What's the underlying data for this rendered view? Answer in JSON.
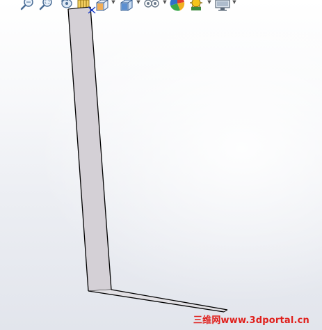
{
  "app": {
    "viewport_label": "SolidWorks graphics area"
  },
  "toolbar": {
    "buttons": [
      {
        "icon": "zoom-to-fit-icon",
        "has_dropdown": false
      },
      {
        "icon": "zoom-to-area-icon",
        "has_dropdown": false
      },
      {
        "icon": "previous-view-icon",
        "has_dropdown": false
      },
      {
        "icon": "section-view-icon",
        "has_dropdown": false
      },
      {
        "icon": "view-orientation-icon",
        "has_dropdown": true
      },
      {
        "icon": "display-style-icon",
        "has_dropdown": true
      },
      {
        "icon": "hide-show-items-icon",
        "has_dropdown": true
      },
      {
        "icon": "edit-appearance-icon",
        "has_dropdown": false
      },
      {
        "icon": "apply-scene-icon",
        "has_dropdown": true
      },
      {
        "icon": "view-settings-icon",
        "has_dropdown": true
      }
    ]
  },
  "watermark": {
    "text": "三维网www.3dportal.cn",
    "color": "#e0201c"
  },
  "colors": {
    "part_face": "#d4d0d6",
    "edge": "#000000",
    "origin_triad": "#1a3cc8"
  }
}
